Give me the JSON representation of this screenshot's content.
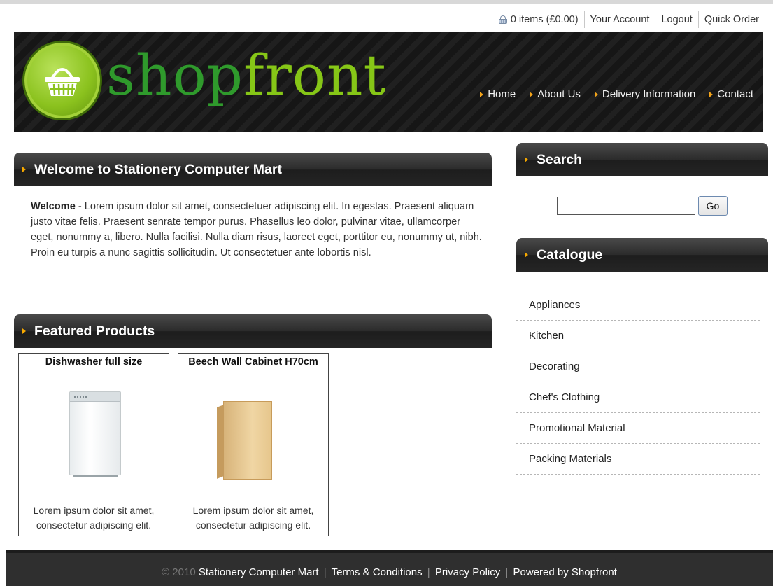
{
  "topbar": {
    "cart": "0 items (£0.00)",
    "account": "Your Account",
    "logout": "Logout",
    "quick_order": "Quick Order"
  },
  "logo": {
    "part1": "shop",
    "part2": "front"
  },
  "nav": [
    {
      "label": "Home"
    },
    {
      "label": "About Us"
    },
    {
      "label": "Delivery Information"
    },
    {
      "label": "Contact"
    }
  ],
  "welcome": {
    "heading": "Welcome to Stationery Computer Mart",
    "lead": "Welcome",
    "body": " - Lorem ipsum dolor sit amet, consectetuer adipiscing elit. In egestas. Praesent aliquam justo vitae felis. Praesent senrate tempor purus. Phasellus leo dolor, pulvinar vitae, ullamcorper eget, nonummy a, libero. Nulla facilisi. Nulla diam risus, laoreet eget, porttitor eu, nonummy ut, nibh. Proin eu turpis a nunc sagittis sollicitudin. Ut consectetuer ante lobortis nisl."
  },
  "featured": {
    "heading": "Featured Products",
    "products": [
      {
        "title": "Dishwasher full size",
        "desc": "Lorem ipsum dolor sit amet, consectetur adipiscing elit.",
        "icon": "dishwasher-image"
      },
      {
        "title": "Beech Wall Cabinet H70cm",
        "desc": "Lorem ipsum dolor sit amet, consectetur adipiscing elit.",
        "icon": "cabinet-image"
      }
    ]
  },
  "search": {
    "heading": "Search",
    "value": "",
    "button": "Go"
  },
  "catalogue": {
    "heading": "Catalogue",
    "items": [
      {
        "label": "Appliances"
      },
      {
        "label": "Kitchen"
      },
      {
        "label": "Decorating"
      },
      {
        "label": "Chef's Clothing"
      },
      {
        "label": "Promotional Material"
      },
      {
        "label": "Packing Materials"
      }
    ]
  },
  "footer": {
    "copyright": "© 2010",
    "company": "Stationery Computer Mart",
    "terms": "Terms & Conditions",
    "privacy": "Privacy Policy",
    "powered": "Powered by Shopfront"
  },
  "colors": {
    "header_bg": "#161616",
    "accent_orange": "#f6a800",
    "logo_green": "#2f9a2c",
    "logo_lime": "#86c617",
    "footer_bg": "#2f2f2f"
  }
}
